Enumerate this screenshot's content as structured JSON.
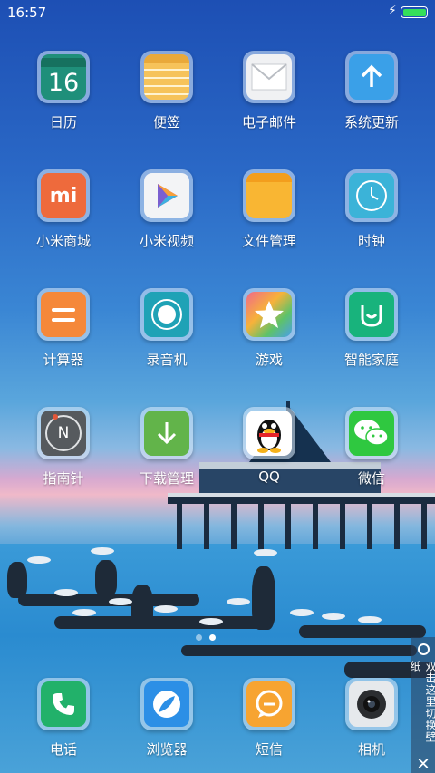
{
  "status_bar": {
    "time": "16:57",
    "battery_level": 1.0
  },
  "apps": [
    {
      "label": "日历",
      "icon": "calendar-icon",
      "text": "16"
    },
    {
      "label": "便签",
      "icon": "notes-icon"
    },
    {
      "label": "电子邮件",
      "icon": "mail-icon"
    },
    {
      "label": "系统更新",
      "icon": "update-icon"
    },
    {
      "label": "小米商城",
      "icon": "mi-store-icon",
      "text": "mi"
    },
    {
      "label": "小米视频",
      "icon": "video-icon"
    },
    {
      "label": "文件管理",
      "icon": "folder-icon"
    },
    {
      "label": "时钟",
      "icon": "clock-icon"
    },
    {
      "label": "计算器",
      "icon": "calculator-icon"
    },
    {
      "label": "录音机",
      "icon": "recorder-icon"
    },
    {
      "label": "游戏",
      "icon": "game-star-icon"
    },
    {
      "label": "智能家庭",
      "icon": "smart-home-icon"
    },
    {
      "label": "指南针",
      "icon": "compass-icon",
      "text": "N"
    },
    {
      "label": "下载管理",
      "icon": "download-icon"
    },
    {
      "label": "QQ",
      "icon": "qq-penguin-icon"
    },
    {
      "label": "微信",
      "icon": "wechat-icon"
    }
  ],
  "dock": [
    {
      "label": "电话",
      "icon": "phone-icon"
    },
    {
      "label": "浏览器",
      "icon": "browser-icon"
    },
    {
      "label": "短信",
      "icon": "message-icon"
    },
    {
      "label": "相机",
      "icon": "camera-icon"
    }
  ],
  "page_indicator": {
    "pages": 2,
    "active": 1
  },
  "wallpaper_hint": {
    "text": "双击这里切换壁纸",
    "close": "✕"
  },
  "colors": {
    "calendar": "#1f8f7a",
    "notes": "#f6c35a",
    "update": "#3aa0e8",
    "mi_store": "#ee6a3c",
    "folder": "#f9b633",
    "clock": "#3bb3d8",
    "calculator": "#f5883a",
    "recorder": "#1fa2b6",
    "smart_home": "#18b37c",
    "compass": "#565a5e",
    "download": "#62b44a",
    "wechat": "#2fc840",
    "phone": "#22b16a",
    "browser": "#2c8fe6",
    "message": "#f7a431",
    "camera": "#e6e9ec"
  }
}
